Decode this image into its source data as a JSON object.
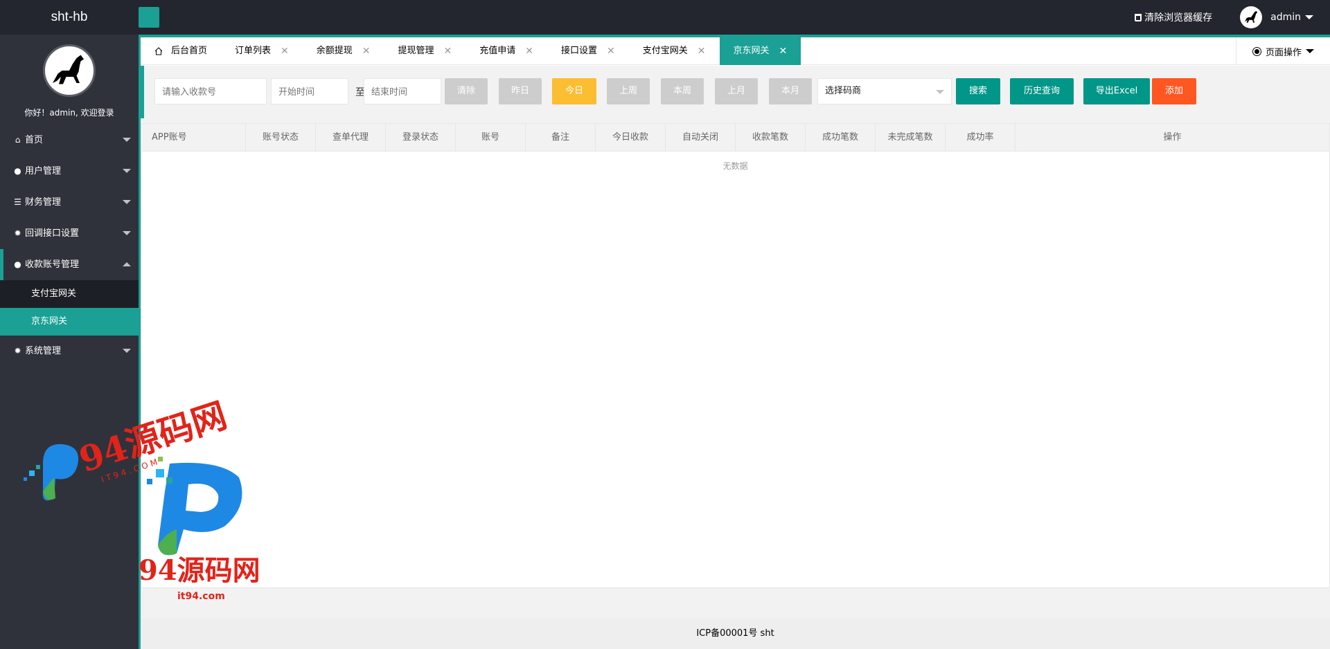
{
  "app": {
    "title": "sht-hb"
  },
  "header": {
    "clear_cache_label": "清除浏览器缓存",
    "user_name": "admin"
  },
  "sidebar": {
    "welcome": "你好！admin, 欢迎登录",
    "items": [
      {
        "label": "首页",
        "icon": "home-icon"
      },
      {
        "label": "用户管理",
        "icon": "user-icon"
      },
      {
        "label": "财务管理",
        "icon": "list-icon"
      },
      {
        "label": "回调接口设置",
        "icon": "gear-icon"
      },
      {
        "label": "收款账号管理",
        "icon": "users-icon"
      },
      {
        "label": "系统管理",
        "icon": "gear-icon"
      }
    ],
    "submenu": [
      {
        "label": "支付宝网关"
      },
      {
        "label": "京东网关"
      }
    ]
  },
  "tabs": [
    {
      "label": "后台首页"
    },
    {
      "label": "订单列表"
    },
    {
      "label": "余额提现"
    },
    {
      "label": "提现管理"
    },
    {
      "label": "充值申请"
    },
    {
      "label": "接口设置"
    },
    {
      "label": "支付宝网关"
    },
    {
      "label": "京东网关"
    }
  ],
  "page_ops_label": "页面操作",
  "filters": {
    "account_placeholder": "请输入收款号",
    "start_placeholder": "开始时间",
    "to_label": "至",
    "end_placeholder": "结束时间",
    "clear": "清除",
    "yesterday": "昨日",
    "today": "今日",
    "last_week": "上周",
    "this_week": "本周",
    "last_month": "上月",
    "this_month": "本月",
    "merchant_select": "选择码商",
    "search": "搜索",
    "history": "历史查询",
    "export": "导出Excel",
    "add": "添加"
  },
  "table": {
    "columns": [
      "APP账号",
      "账号状态",
      "查单代理",
      "登录状态",
      "账号",
      "备注",
      "今日收款",
      "自动关闭",
      "收款笔数",
      "成功笔数",
      "未完成笔数",
      "成功率",
      "操作"
    ],
    "empty": "无数据"
  },
  "footer": {
    "text": "ICP备00001号 sht"
  },
  "watermark": {
    "text_main": "94源码网",
    "text_url": "it94.com",
    "text_sub": "I T 9 4 . C O M"
  },
  "colors": {
    "accent": "#1aa094",
    "primary_button": "#009688",
    "warning": "#fbbd32",
    "danger": "#ff5722",
    "header_bg": "#23262e",
    "sidebar_bg": "#2f323b"
  }
}
